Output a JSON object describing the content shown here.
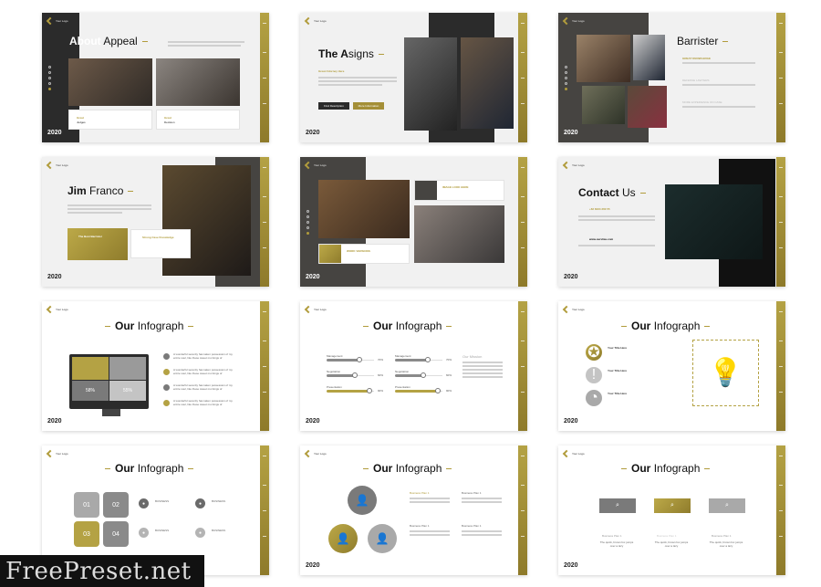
{
  "common": {
    "logo": "Your Logo",
    "year": "2020"
  },
  "slides": {
    "about": {
      "title_bold": "About",
      "title_rest": "Appeal",
      "cards": [
        {
          "caption": "Great",
          "label": "Judges"
        },
        {
          "caption": "Great",
          "label": "Decision"
        }
      ]
    },
    "asigns": {
      "title_bold": "The A",
      "title_rest": "signs",
      "subtitle": "Great Attorney Here",
      "btn1": "Find Description",
      "btn2": "More Information"
    },
    "barrister": {
      "title": "Barrister",
      "items": [
        "GREAT KNOWLEDGE",
        "DEFENSE LAWYERS",
        "MORE EXPERIENCE ON CASE"
      ]
    },
    "jim": {
      "title_bold": "Jim",
      "title_rest": "Franco",
      "card1": "The Best Barrister",
      "card2": "Strong Case Knowledge"
    },
    "team": {
      "card1": "IMAGE LOOK HERE",
      "card2": "WORK VERSIONS"
    },
    "contact": {
      "title_bold": "Contact",
      "title_rest": "Us",
      "phone": "+62 8234 360 55",
      "web": "www.ourslias.com"
    },
    "info1": {
      "title_bold": "Our",
      "title_rest": "Infograph",
      "pct1": "58%",
      "pct2": "55%",
      "items": [
        "A wonderful serenity has taken possession of my entire soul, like these sweet mornings of",
        "A wonderful serenity has taken possession of my entire soul, like these sweet mornings of",
        "A wonderful serenity has taken possession of my entire soul, like these sweet mornings of",
        "A wonderful serenity has taken possession of my entire soul, like these sweet mornings of"
      ]
    },
    "info2": {
      "title_bold": "Our",
      "title_rest": "Infograph",
      "mission": "Our Mission",
      "bars": [
        {
          "label": "Management",
          "value": 70
        },
        {
          "label": "Negotiation",
          "value": 60
        },
        {
          "label": "Presentation",
          "value": 90
        }
      ]
    },
    "info3": {
      "title_bold": "Our",
      "title_rest": "Infograph",
      "items": [
        "Your Title Here",
        "Your Title Here",
        "Your Title Here"
      ]
    },
    "info4": {
      "title_bold": "Our",
      "title_rest": "Infograph",
      "tiles": [
        "01",
        "02",
        "03",
        "04"
      ],
      "items": [
        "BUSINESS",
        "BUSINESS",
        "BUSINESS",
        "BUSINESS"
      ]
    },
    "info5": {
      "title_bold": "Our",
      "title_rest": "Infograph",
      "plans": [
        "Business Plan 1",
        "Business Plan 1",
        "Business Plan 1",
        "Business Plan 1"
      ]
    },
    "info6": {
      "title_bold": "Our",
      "title_rest": "Infograph",
      "plans": [
        "Business Plan 1",
        "Business Plan 1",
        "Business Plan 1"
      ],
      "desc": "The quick, brown fox jumps over a lazy"
    }
  },
  "colors": {
    "gold": "#b19c3c",
    "dark": "#2b2b2b",
    "grey": "#7a7a7a"
  },
  "watermark": "FreePreset.net"
}
